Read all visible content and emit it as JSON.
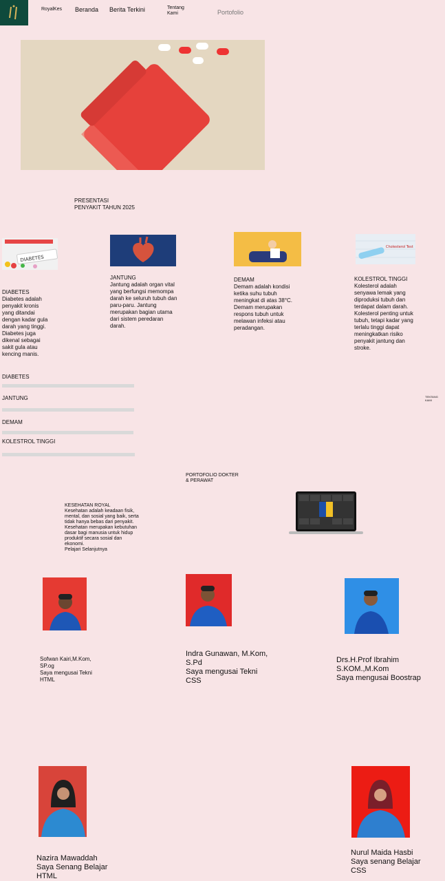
{
  "nav": {
    "brand": "RoyalKes",
    "home": "Beranda",
    "news": "Berita Terkini",
    "about": "Tentang Kami",
    "portfolio": "Portofolio"
  },
  "presentation": {
    "title": "PRESENTASI PENYAKIT TAHUN 2025"
  },
  "cards": [
    {
      "title": "DIABETES",
      "text": "Diabetes adalah penyakit kronis yang ditandai dengan kadar gula darah yang tinggi. Diabetes juga dikenal sebagai sakit gula atau kencing manis.",
      "image_label": "DIABETES"
    },
    {
      "title": "JANTUNG",
      "text": "Jantung adalah organ vital yang berfungsi memompa darah ke seluruh tubuh dan paru-paru. Jantung merupakan bagian utama dari sistem peredaran darah."
    },
    {
      "title": "DEMAM",
      "text": "Demam adalah kondisi ketika suhu tubuh meningkat di atas 38°C. Demam merupakan respons tubuh untuk melawan infeksi atau peradangan."
    },
    {
      "title": "KOLESTROL TINGGI",
      "text": "Kolesterol adalah senyawa lemak yang diproduksi tubuh dan terdapat dalam darah. Kolesterol penting untuk tubuh, tetapi kadar yang terlalu tinggi dapat meningkatkan risiko penyakit jantung dan stroke.",
      "image_label": "Cholesterol Test"
    }
  ],
  "progress": [
    {
      "label": "DIABETES",
      "value": 1
    },
    {
      "label": "JANTUNG",
      "value": 1
    },
    {
      "label": "DEMAM",
      "value": 1
    },
    {
      "label": "KOLESTROL TINGGI",
      "value": 1
    }
  ],
  "side_note": "TENTANG KAMI",
  "portfolio": {
    "title": "PORTOFOLIO DOKTER & PERAWAT",
    "health_title": "KESEHATAN ROYAL",
    "health_text": "Kesehatan adalah keadaan fisik, mental, dan sosial yang baik, serta tidak hanya bebas dari penyakit. Kesehatan merupakan kebutuhan dasar bagi manusia untuk hidup produktif secara sosial dan ekonomi.",
    "read_more": "Pelajari Selanjutnya"
  },
  "team": [
    {
      "name": "Sofwan Kairi,M.Kom, SP.og",
      "skill": "Saya mengusai Tekni HTML",
      "bg": "#e53a32"
    },
    {
      "name": "Indra Gunawan, M.Kom, S.Pd",
      "skill": "Saya mengusai Tekni CSS",
      "bg": "#e02a2a"
    },
    {
      "name": "Drs.H.Prof Ibrahim S.KOM.,M.Kom",
      "skill": "Saya mengusai Boostrap",
      "bg": "#2f8fe6"
    },
    {
      "name": "Nazira Mawaddah",
      "skill": "Saya Senang Belajar HTML",
      "bg": "#d8443a"
    },
    {
      "name": "Nurul Maida Hasbi",
      "skill": "Saya senang Belajar CSS",
      "bg": "#ec1c14"
    }
  ],
  "colors": {
    "page_bg": "#f8e4e6",
    "logo_bg": "#0f4a3c",
    "progress_track": "#d9d9d9"
  }
}
